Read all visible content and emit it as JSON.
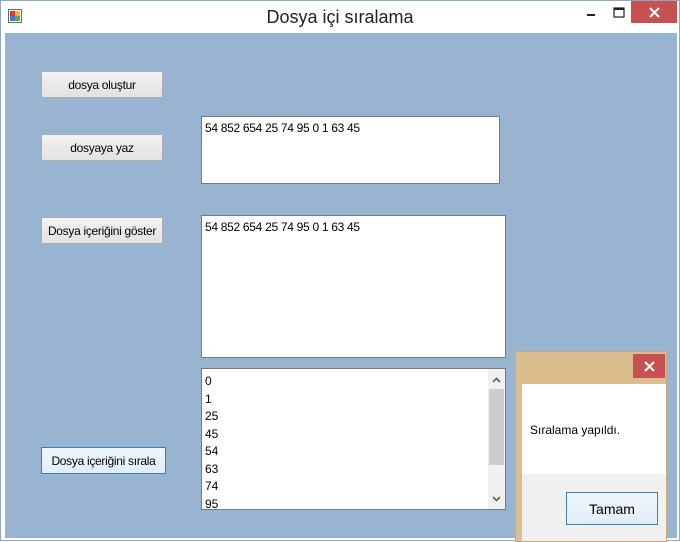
{
  "window": {
    "title": "Dosya içi sıralama",
    "icons": {
      "app": "app-window-icon",
      "minimize": "minimize-icon",
      "maximize": "maximize-icon",
      "close": "close-icon"
    }
  },
  "buttons": {
    "create_file": "dosya oluştur",
    "write_file": "dosyaya yaz",
    "show_content": "Dosya içeriğini göster",
    "sort_content": "Dosya içeriğini sırala"
  },
  "inputs": {
    "write_text": "54 852 654 25 74 95 0 1 63 45",
    "display_text": "54 852 654 25 74 95 0 1 63 45"
  },
  "sorted_list": {
    "items": [
      "0",
      "1",
      "25",
      "45",
      "54",
      "63",
      "74",
      "95"
    ],
    "icons": {
      "up": "scroll-up-icon",
      "down": "scroll-down-icon"
    }
  },
  "message_box": {
    "text": "Sıralama yapıldı.",
    "ok_label": "Tamam",
    "close_icon": "close-icon"
  },
  "colors": {
    "client_background": "#99b4d1",
    "close_button": "#c75050",
    "message_frame": "#dcbd8e"
  }
}
